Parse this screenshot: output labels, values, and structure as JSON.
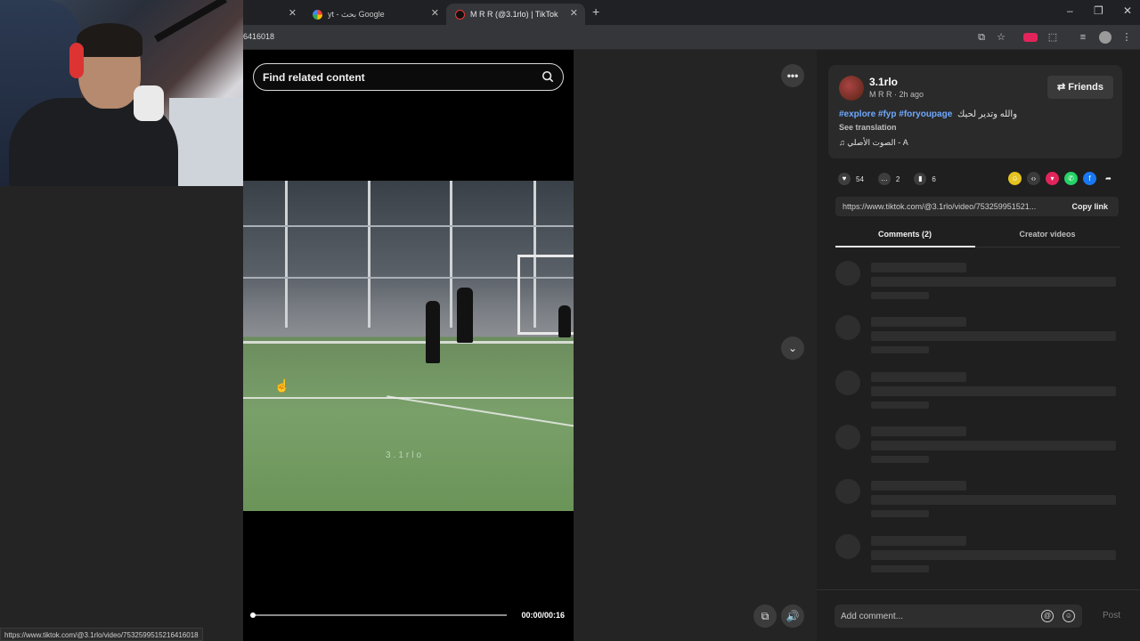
{
  "browser": {
    "tabs": [
      {
        "title": "",
        "has_close": true
      },
      {
        "title": "yt - بحث Google",
        "has_close": true
      },
      {
        "title": "M R R (@3.1rlo) | TikTok",
        "has_close": true
      }
    ],
    "new_tab": "+",
    "window_controls": {
      "minimize": "–",
      "restore": "❐",
      "close": "✕"
    },
    "address_fragment": "6416018"
  },
  "video": {
    "search_placeholder": "Find related content",
    "watermark": "3.1rlo",
    "time": "00:00/00:16",
    "progress": 0.0
  },
  "post": {
    "username": "3.1rlo",
    "meta": "M R R · 2h ago",
    "friends_label": "⇄ Friends",
    "hashtags": "#explore #fyp #foryoupage",
    "caption_arabic": "والله وتدير لحيك",
    "see_translation": "See translation",
    "music": "♫ الصوت الأصلي - A",
    "likes": "54",
    "comments": "2",
    "saves": "6",
    "link": "https://www.tiktok.com/@3.1rlo/video/753259951521...",
    "copy_link": "Copy link",
    "tabs": {
      "comments": "Comments (2)",
      "creator": "Creator videos"
    },
    "add_comment_placeholder": "Add comment...",
    "post_label": "Post"
  },
  "status_url": "https://www.tiktok.com/@3.1rlo/video/7532599515216416018",
  "colors": {
    "accent_tag": "#6fa8ff",
    "panel_bg": "#1f1f1f",
    "page_bg": "#242424"
  }
}
